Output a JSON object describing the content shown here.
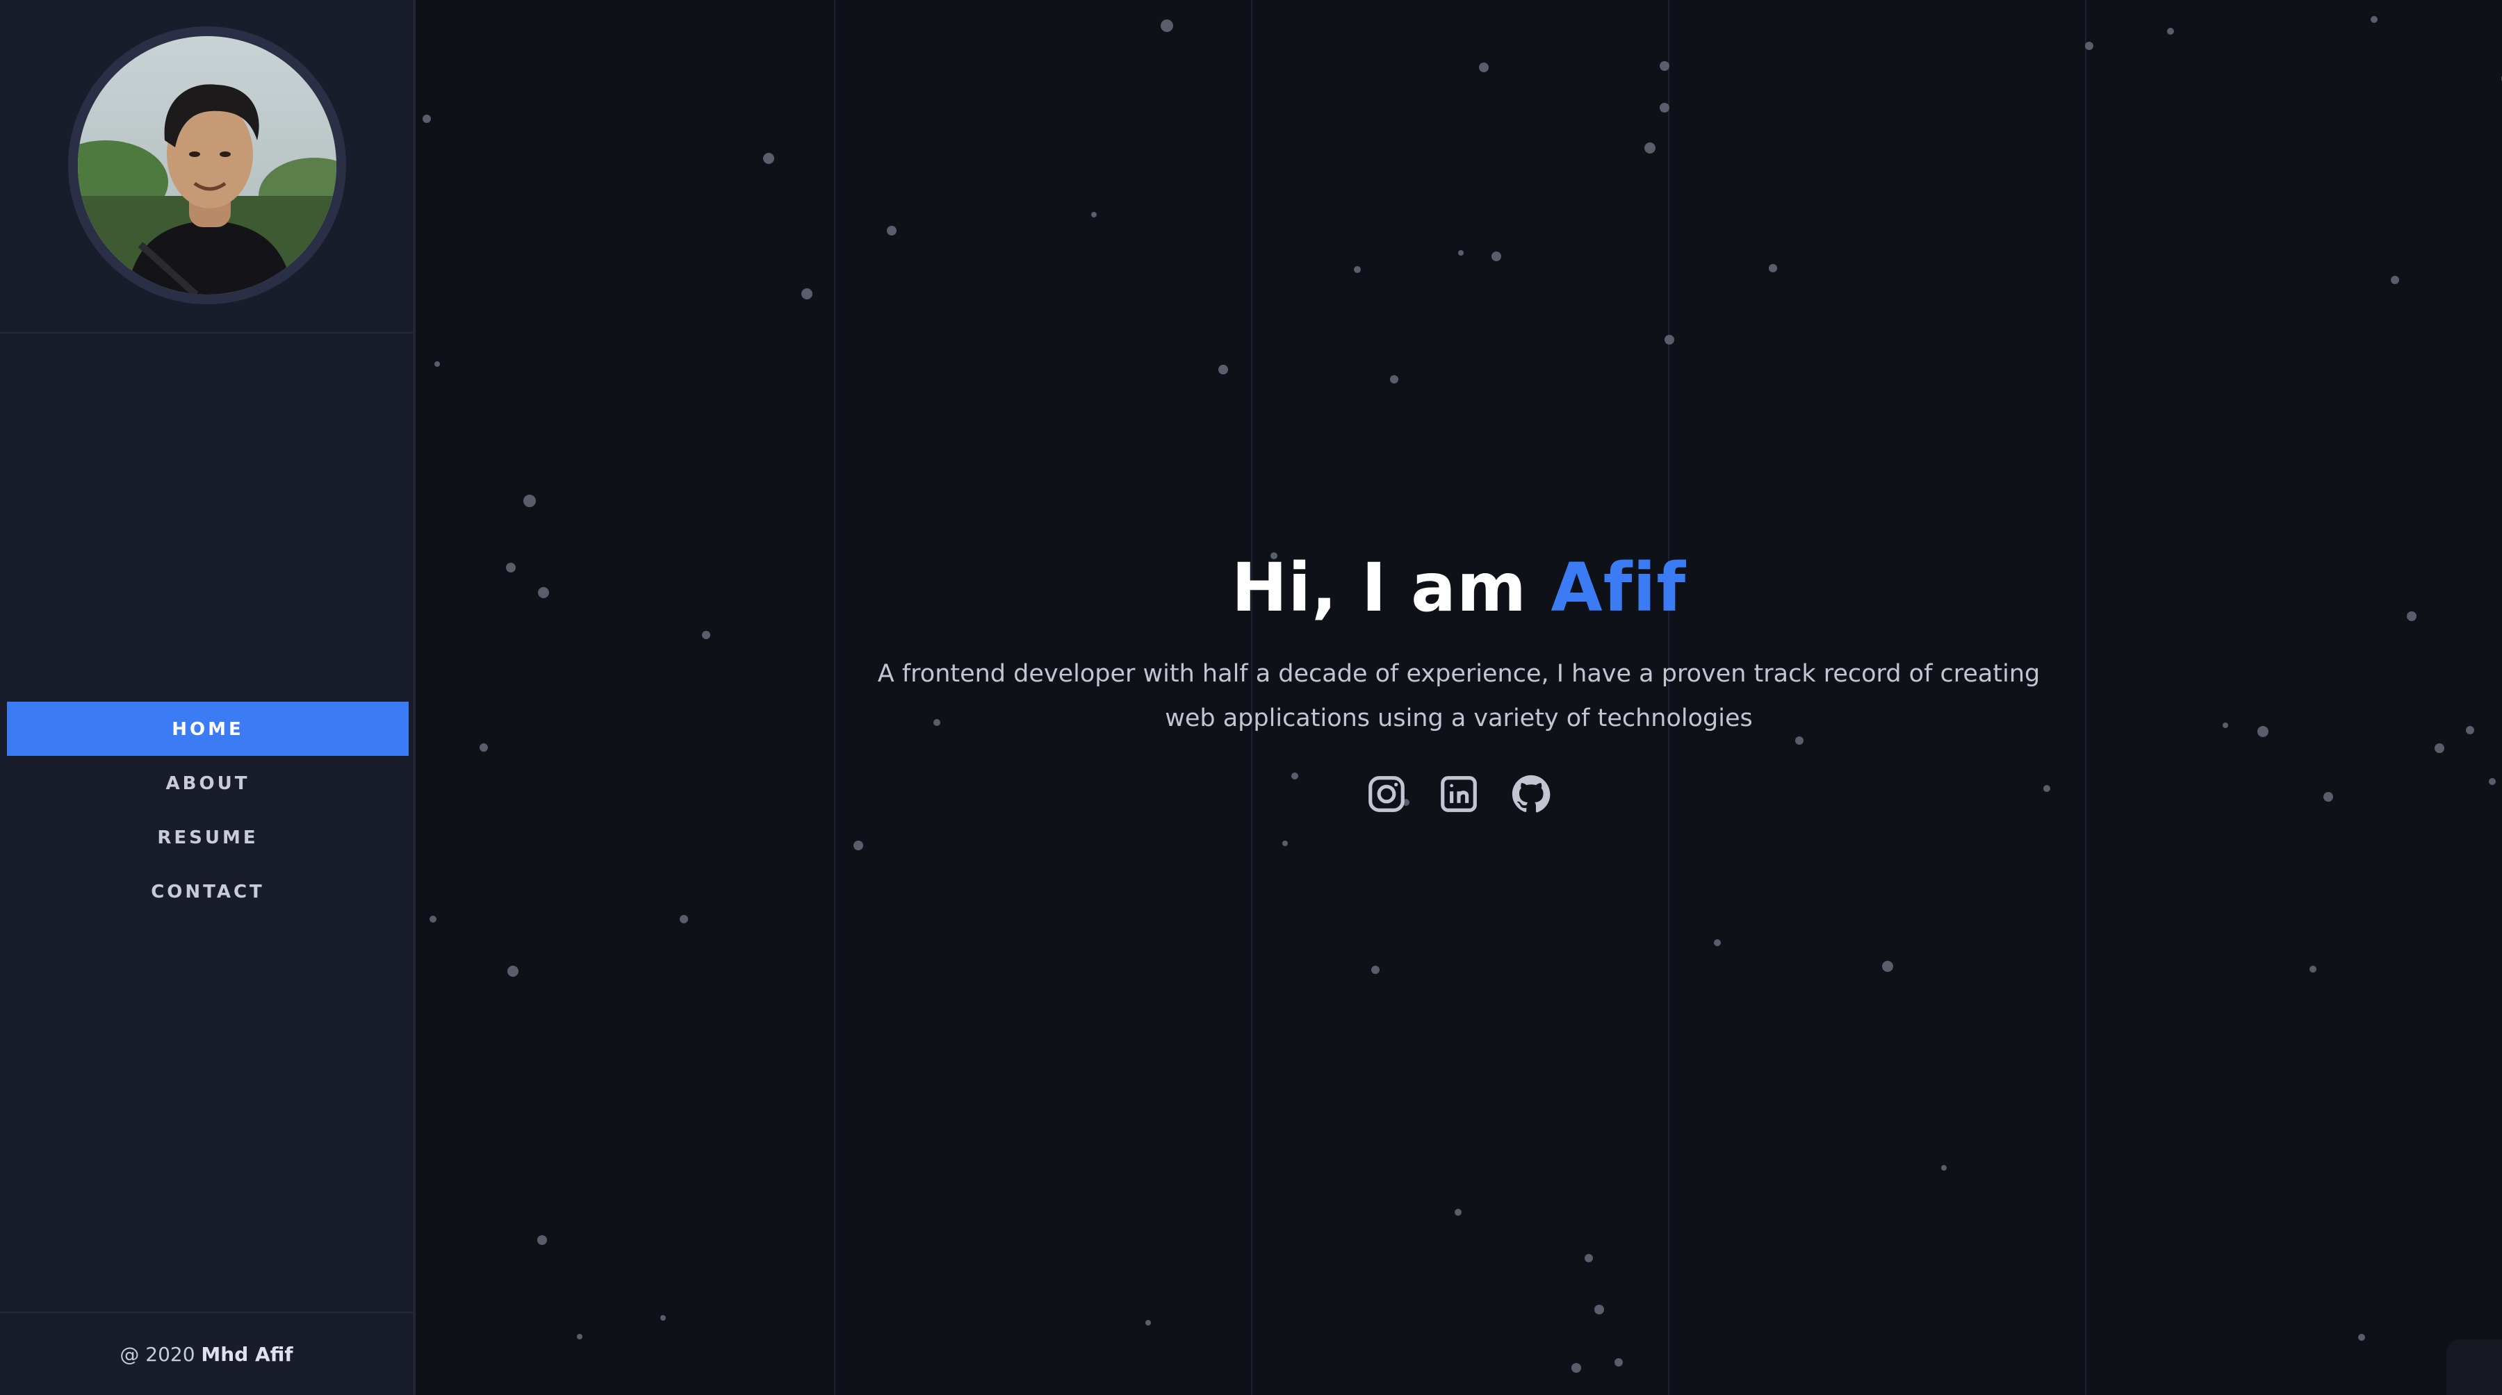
{
  "sidebar": {
    "avatar_alt": "Profile photo",
    "nav": [
      {
        "label": "HOME",
        "active": true
      },
      {
        "label": "ABOUT",
        "active": false
      },
      {
        "label": "RESUME",
        "active": false
      },
      {
        "label": "CONTACT",
        "active": false
      }
    ],
    "footer": {
      "prefix": "@ 2020 ",
      "name": "Mhd Afif"
    }
  },
  "hero": {
    "greeting": "Hi, I am ",
    "name": "Afif",
    "description": "A frontend developer with half a decade of experience, I have a proven track record of creating web applications using a variety of technologies"
  },
  "socials": [
    {
      "icon": "instagram-icon"
    },
    {
      "icon": "linkedin-icon"
    },
    {
      "icon": "github-icon"
    }
  ],
  "colors": {
    "accent": "#3b7cf5",
    "background": "#0f1119",
    "sidebar": "#191c2a"
  }
}
